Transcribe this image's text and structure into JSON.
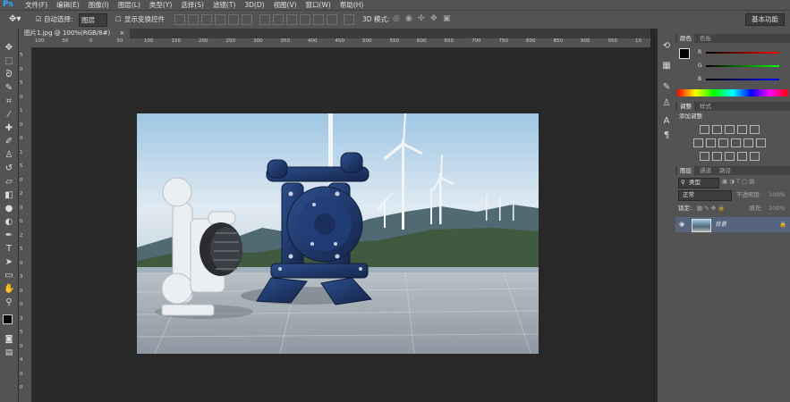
{
  "app": {
    "logo": "Ps"
  },
  "menu": [
    "文件(F)",
    "编辑(E)",
    "图像(I)",
    "图层(L)",
    "类型(Y)",
    "选择(S)",
    "滤镜(T)",
    "3D(D)",
    "视图(V)",
    "窗口(W)",
    "帮助(H)"
  ],
  "options": {
    "auto_select_label": "自动选择:",
    "auto_select_value": "图层",
    "show_transform_label": "显示变换控件",
    "mode_3d_label": "3D 模式:",
    "workspace": "基本功能"
  },
  "document": {
    "tab_title": "图片1.jpg @ 100%(RGB/8#)",
    "close_glyph": "×"
  },
  "ruler": {
    "h_ticks": [
      "100",
      "50",
      "0",
      "50",
      "100",
      "150",
      "200",
      "250",
      "300",
      "350",
      "400",
      "450",
      "500",
      "550",
      "600",
      "650",
      "700",
      "750",
      "800",
      "850",
      "900",
      "950",
      "10"
    ],
    "v_ticks": [
      "5",
      "0",
      "5",
      "0",
      "1",
      "0",
      "0",
      "1",
      "5",
      "0",
      "2",
      "0",
      "0",
      "2",
      "5",
      "0",
      "3",
      "0",
      "0",
      "3",
      "5",
      "0",
      "4",
      "0",
      "0"
    ]
  },
  "color_panel": {
    "tabs": [
      "颜色",
      "色板"
    ],
    "channels": [
      {
        "label": "R",
        "value": "0",
        "color": "#ff0000"
      },
      {
        "label": "G",
        "value": "0",
        "color": "#00ff00"
      },
      {
        "label": "B",
        "value": "0",
        "color": "#0000ff"
      }
    ]
  },
  "adjust_panel": {
    "tabs": [
      "调整",
      "样式"
    ],
    "title": "添加调整"
  },
  "layers_panel": {
    "tabs": [
      "图层",
      "通道",
      "路径"
    ],
    "filter_label": "类型",
    "blend_mode": "正常",
    "opacity_label": "不透明度:",
    "opacity_value": "100%",
    "lock_label": "锁定:",
    "fill_label": "填充:",
    "fill_value": "100%",
    "layer_name": "背景"
  },
  "colors": {
    "accent": "#31a8ff",
    "panel": "#535353",
    "canvas": "#282828"
  }
}
